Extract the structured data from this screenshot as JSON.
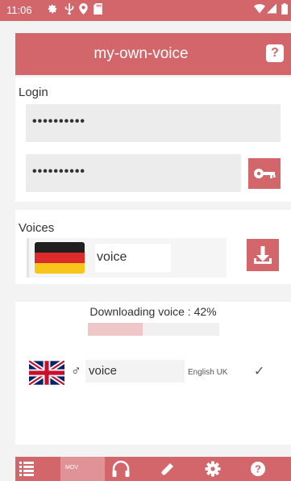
{
  "status_bar": {
    "time": "11:06",
    "left_icons": [
      "gear-icon",
      "usb-icon",
      "location-icon",
      "sd-card-icon"
    ],
    "right_icons": [
      "wifi-icon",
      "signal-icon",
      "battery-icon"
    ]
  },
  "app_bar": {
    "title": "my-own-voice",
    "help_icon": "help-icon"
  },
  "login": {
    "label": "Login",
    "username_value": "••••••••••",
    "password_value": "••••••••••",
    "key_icon": "key-icon"
  },
  "voices": {
    "label": "Voices",
    "item_name": "voice",
    "item_flag": "germany-flag",
    "download_icon": "download-icon"
  },
  "download": {
    "status_text": "Downloading voice : 42%",
    "progress": 0.42
  },
  "installed": {
    "name": "voice",
    "gender_symbol": "♂",
    "language": "English UK",
    "check_symbol": "✓",
    "flag": "uk-flag"
  },
  "bottom_nav": {
    "items": [
      "list-icon",
      "mov-tab",
      "headphones-icon",
      "pencil-icon",
      "gear-icon",
      "help-icon"
    ],
    "mov_label": "MOV",
    "active_item": "mov-tab"
  },
  "colors": {
    "accent": "#d2666a",
    "accent_light": "#e09396",
    "progress_fill": "#efc7c9",
    "background": "#f3f3f3"
  }
}
